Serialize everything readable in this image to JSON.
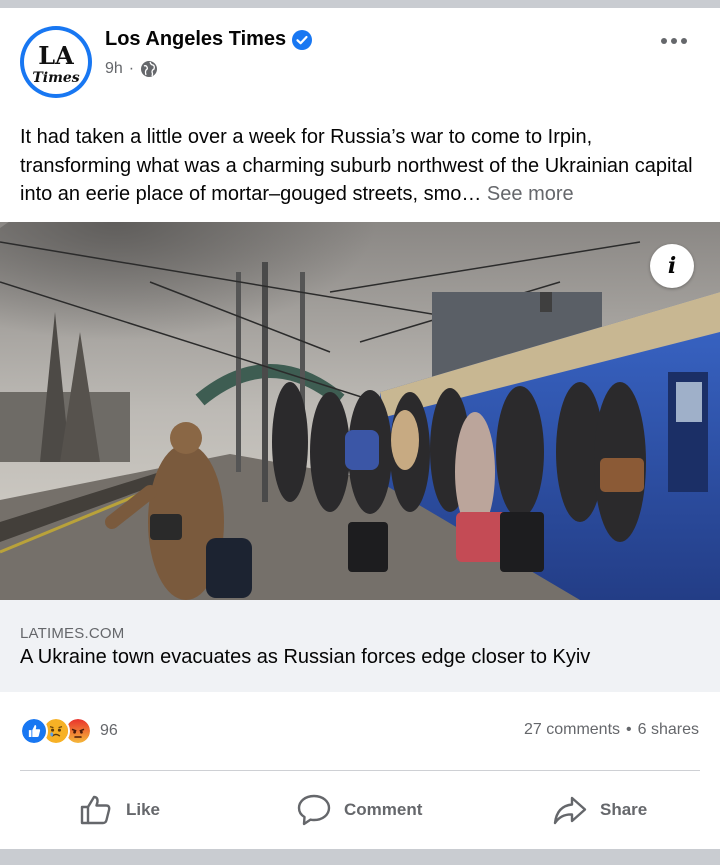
{
  "post": {
    "page_name": "Los Angeles Times",
    "avatar_text": {
      "top": "LA",
      "bottom": "Times"
    },
    "time": "9h",
    "separator": "·",
    "text": "It had taken a little over a week for Russia’s war to come to Irpin, transforming what was a charming suburb northwest of the Ukrainian capital into an eerie place of mortar–gouged streets, smo…",
    "see_more": "See more"
  },
  "link": {
    "domain": "LATIMES.COM",
    "title": "A Ukraine town evacuates as Russian forces edge closer to Kyiv"
  },
  "stats": {
    "reaction_icons": [
      "like-icon",
      "sad-icon",
      "angry-icon"
    ],
    "reaction_count": "96",
    "comments": "27 comments",
    "dot": "•",
    "shares": "6 shares"
  },
  "actions": {
    "like": "Like",
    "comment": "Comment",
    "share": "Share"
  },
  "colors": {
    "brand_blue": "#1877f2",
    "secondary_text": "#65676b",
    "link_bg": "#f0f2f5",
    "angry": "#e9710f",
    "sad": "#f7b125"
  }
}
